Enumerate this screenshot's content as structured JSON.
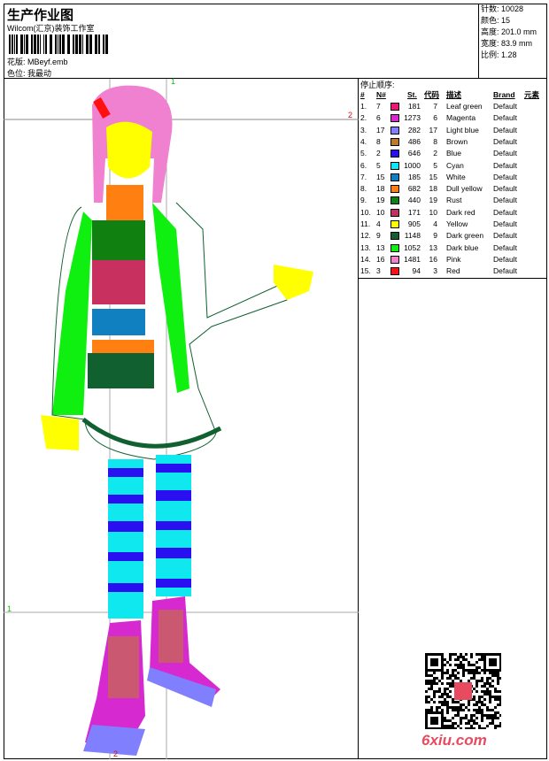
{
  "header": {
    "title": "生产作业图",
    "company": "Wilcom(汇京)装饰工作室",
    "design_label": "花版:",
    "design_value": "MBeyf.emb",
    "colorway_label": "色位:",
    "colorway_value": "我最动"
  },
  "stats": [
    {
      "label": "针数:",
      "value": "10028"
    },
    {
      "label": "颜色:",
      "value": "15"
    },
    {
      "label": "高度:",
      "value": "201.0 mm"
    },
    {
      "label": "宽度:",
      "value": "83.9 mm"
    },
    {
      "label": "比例:",
      "value": "1.28"
    }
  ],
  "table": {
    "caption": "停止顺序:",
    "headers": [
      "#",
      "N#",
      "St.",
      "代码",
      "描述",
      "Brand",
      "元素"
    ],
    "rows": [
      {
        "i": "1.",
        "n": "7",
        "color": "#f0157a",
        "st": "181",
        "code": "7",
        "desc": "Leaf green",
        "brand": "Default"
      },
      {
        "i": "2.",
        "n": "6",
        "color": "#d62ad0",
        "st": "1273",
        "code": "6",
        "desc": "Magenta",
        "brand": "Default"
      },
      {
        "i": "3.",
        "n": "17",
        "color": "#8080ff",
        "st": "282",
        "code": "17",
        "desc": "Light blue",
        "brand": "Default"
      },
      {
        "i": "4.",
        "n": "8",
        "color": "#c07830",
        "st": "486",
        "code": "8",
        "desc": "Brown",
        "brand": "Default"
      },
      {
        "i": "5.",
        "n": "2",
        "color": "#2a10f0",
        "st": "646",
        "code": "2",
        "desc": "Blue",
        "brand": "Default"
      },
      {
        "i": "6.",
        "n": "5",
        "color": "#10e8f0",
        "st": "1000",
        "code": "5",
        "desc": "Cyan",
        "brand": "Default"
      },
      {
        "i": "7.",
        "n": "15",
        "color": "#1080c0",
        "st": "185",
        "code": "15",
        "desc": "White",
        "brand": "Default"
      },
      {
        "i": "8.",
        "n": "18",
        "color": "#ff8010",
        "st": "682",
        "code": "18",
        "desc": "Dull yellow",
        "brand": "Default"
      },
      {
        "i": "9.",
        "n": "19",
        "color": "#108010",
        "st": "440",
        "code": "19",
        "desc": "Rust",
        "brand": "Default"
      },
      {
        "i": "10.",
        "n": "10",
        "color": "#c83060",
        "st": "171",
        "code": "10",
        "desc": "Dark red",
        "brand": "Default"
      },
      {
        "i": "11.",
        "n": "4",
        "color": "#ffff00",
        "st": "905",
        "code": "4",
        "desc": "Yellow",
        "brand": "Default"
      },
      {
        "i": "12.",
        "n": "9",
        "color": "#106030",
        "st": "1148",
        "code": "9",
        "desc": "Dark green",
        "brand": "Default"
      },
      {
        "i": "13.",
        "n": "13",
        "color": "#10f010",
        "st": "1052",
        "code": "13",
        "desc": "Dark blue",
        "brand": "Default"
      },
      {
        "i": "14.",
        "n": "16",
        "color": "#f080d0",
        "st": "1481",
        "code": "16",
        "desc": "Pink",
        "brand": "Default"
      },
      {
        "i": "15.",
        "n": "3",
        "color": "#ff1010",
        "st": "94",
        "code": "3",
        "desc": "Red",
        "brand": "Default"
      }
    ]
  },
  "guides": {
    "v1": "1",
    "h2": "2",
    "h1": "1",
    "v2": "2"
  },
  "watermark": "6xiu.com"
}
